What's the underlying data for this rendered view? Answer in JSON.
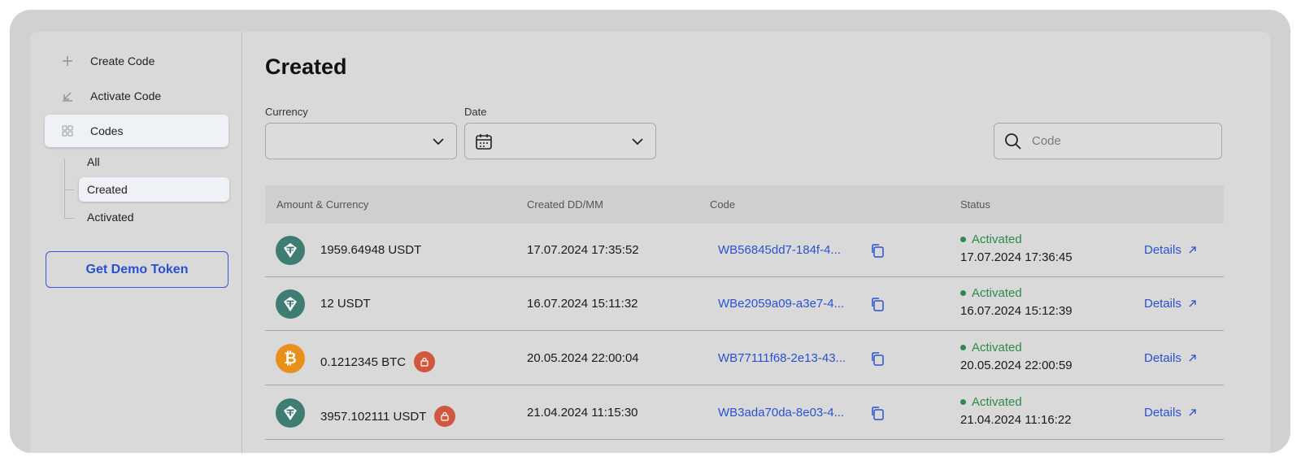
{
  "sidebar": {
    "items": [
      {
        "label": "Create Code",
        "icon": "plus-icon"
      },
      {
        "label": "Activate Code",
        "icon": "arrow-down-left-icon"
      },
      {
        "label": "Codes",
        "icon": "grid-icon"
      }
    ],
    "sub_items": [
      {
        "label": "All"
      },
      {
        "label": "Created"
      },
      {
        "label": "Activated"
      }
    ],
    "demo_button": "Get Demo Token"
  },
  "main": {
    "title": "Created",
    "filters": {
      "currency_label": "Currency",
      "currency_value": "",
      "date_label": "Date",
      "date_value": ""
    },
    "search": {
      "placeholder": "Code",
      "value": ""
    },
    "table": {
      "headers": [
        "Amount & Currency",
        "Created DD/MM",
        "Code",
        "Status"
      ],
      "rows": [
        {
          "coin": "usdt",
          "amount": "1959.64948 USDT",
          "locked": false,
          "created": "17.07.2024 17:35:52",
          "code": "WB56845dd7-184f-4...",
          "status": "Activated",
          "status_time": "17.07.2024 17:36:45",
          "details": "Details"
        },
        {
          "coin": "usdt",
          "amount": "12 USDT",
          "locked": false,
          "created": "16.07.2024 15:11:32",
          "code": "WBe2059a09-a3e7-4...",
          "status": "Activated",
          "status_time": "16.07.2024 15:12:39",
          "details": "Details"
        },
        {
          "coin": "btc",
          "amount": "0.1212345 BTC",
          "locked": true,
          "created": "20.05.2024 22:00:04",
          "code": "WB77111f68-2e13-43...",
          "status": "Activated",
          "status_time": "20.05.2024 22:00:59",
          "details": "Details"
        },
        {
          "coin": "usdt",
          "amount": "3957.102111 USDT",
          "locked": true,
          "created": "21.04.2024 11:15:30",
          "code": "WB3ada70da-8e03-4...",
          "status": "Activated",
          "status_time": "21.04.2024 11:16:22",
          "details": "Details"
        }
      ]
    }
  },
  "colors": {
    "accent": "#2a52d0",
    "status_green": "#2e8a4a",
    "usdt": "#3f7c74",
    "btc": "#e8901a",
    "lock": "#d0583f"
  }
}
